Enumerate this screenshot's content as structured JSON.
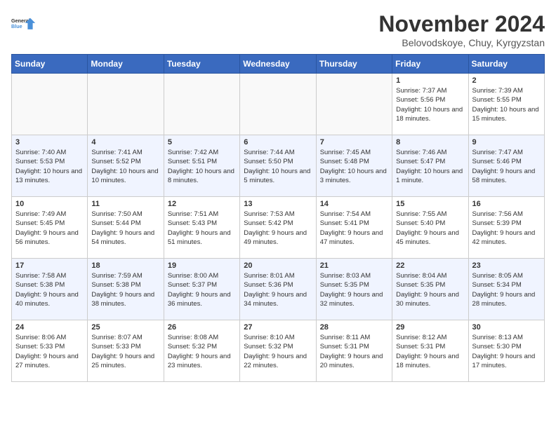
{
  "logo": {
    "line1": "General",
    "line2": "Blue"
  },
  "title": "November 2024",
  "subtitle": "Belovodskoye, Chuy, Kyrgyzstan",
  "weekdays": [
    "Sunday",
    "Monday",
    "Tuesday",
    "Wednesday",
    "Thursday",
    "Friday",
    "Saturday"
  ],
  "weeks": [
    [
      {
        "day": "",
        "detail": ""
      },
      {
        "day": "",
        "detail": ""
      },
      {
        "day": "",
        "detail": ""
      },
      {
        "day": "",
        "detail": ""
      },
      {
        "day": "",
        "detail": ""
      },
      {
        "day": "1",
        "detail": "Sunrise: 7:37 AM\nSunset: 5:56 PM\nDaylight: 10 hours and 18 minutes."
      },
      {
        "day": "2",
        "detail": "Sunrise: 7:39 AM\nSunset: 5:55 PM\nDaylight: 10 hours and 15 minutes."
      }
    ],
    [
      {
        "day": "3",
        "detail": "Sunrise: 7:40 AM\nSunset: 5:53 PM\nDaylight: 10 hours and 13 minutes."
      },
      {
        "day": "4",
        "detail": "Sunrise: 7:41 AM\nSunset: 5:52 PM\nDaylight: 10 hours and 10 minutes."
      },
      {
        "day": "5",
        "detail": "Sunrise: 7:42 AM\nSunset: 5:51 PM\nDaylight: 10 hours and 8 minutes."
      },
      {
        "day": "6",
        "detail": "Sunrise: 7:44 AM\nSunset: 5:50 PM\nDaylight: 10 hours and 5 minutes."
      },
      {
        "day": "7",
        "detail": "Sunrise: 7:45 AM\nSunset: 5:48 PM\nDaylight: 10 hours and 3 minutes."
      },
      {
        "day": "8",
        "detail": "Sunrise: 7:46 AM\nSunset: 5:47 PM\nDaylight: 10 hours and 1 minute."
      },
      {
        "day": "9",
        "detail": "Sunrise: 7:47 AM\nSunset: 5:46 PM\nDaylight: 9 hours and 58 minutes."
      }
    ],
    [
      {
        "day": "10",
        "detail": "Sunrise: 7:49 AM\nSunset: 5:45 PM\nDaylight: 9 hours and 56 minutes."
      },
      {
        "day": "11",
        "detail": "Sunrise: 7:50 AM\nSunset: 5:44 PM\nDaylight: 9 hours and 54 minutes."
      },
      {
        "day": "12",
        "detail": "Sunrise: 7:51 AM\nSunset: 5:43 PM\nDaylight: 9 hours and 51 minutes."
      },
      {
        "day": "13",
        "detail": "Sunrise: 7:53 AM\nSunset: 5:42 PM\nDaylight: 9 hours and 49 minutes."
      },
      {
        "day": "14",
        "detail": "Sunrise: 7:54 AM\nSunset: 5:41 PM\nDaylight: 9 hours and 47 minutes."
      },
      {
        "day": "15",
        "detail": "Sunrise: 7:55 AM\nSunset: 5:40 PM\nDaylight: 9 hours and 45 minutes."
      },
      {
        "day": "16",
        "detail": "Sunrise: 7:56 AM\nSunset: 5:39 PM\nDaylight: 9 hours and 42 minutes."
      }
    ],
    [
      {
        "day": "17",
        "detail": "Sunrise: 7:58 AM\nSunset: 5:38 PM\nDaylight: 9 hours and 40 minutes."
      },
      {
        "day": "18",
        "detail": "Sunrise: 7:59 AM\nSunset: 5:38 PM\nDaylight: 9 hours and 38 minutes."
      },
      {
        "day": "19",
        "detail": "Sunrise: 8:00 AM\nSunset: 5:37 PM\nDaylight: 9 hours and 36 minutes."
      },
      {
        "day": "20",
        "detail": "Sunrise: 8:01 AM\nSunset: 5:36 PM\nDaylight: 9 hours and 34 minutes."
      },
      {
        "day": "21",
        "detail": "Sunrise: 8:03 AM\nSunset: 5:35 PM\nDaylight: 9 hours and 32 minutes."
      },
      {
        "day": "22",
        "detail": "Sunrise: 8:04 AM\nSunset: 5:35 PM\nDaylight: 9 hours and 30 minutes."
      },
      {
        "day": "23",
        "detail": "Sunrise: 8:05 AM\nSunset: 5:34 PM\nDaylight: 9 hours and 28 minutes."
      }
    ],
    [
      {
        "day": "24",
        "detail": "Sunrise: 8:06 AM\nSunset: 5:33 PM\nDaylight: 9 hours and 27 minutes."
      },
      {
        "day": "25",
        "detail": "Sunrise: 8:07 AM\nSunset: 5:33 PM\nDaylight: 9 hours and 25 minutes."
      },
      {
        "day": "26",
        "detail": "Sunrise: 8:08 AM\nSunset: 5:32 PM\nDaylight: 9 hours and 23 minutes."
      },
      {
        "day": "27",
        "detail": "Sunrise: 8:10 AM\nSunset: 5:32 PM\nDaylight: 9 hours and 22 minutes."
      },
      {
        "day": "28",
        "detail": "Sunrise: 8:11 AM\nSunset: 5:31 PM\nDaylight: 9 hours and 20 minutes."
      },
      {
        "day": "29",
        "detail": "Sunrise: 8:12 AM\nSunset: 5:31 PM\nDaylight: 9 hours and 18 minutes."
      },
      {
        "day": "30",
        "detail": "Sunrise: 8:13 AM\nSunset: 5:30 PM\nDaylight: 9 hours and 17 minutes."
      }
    ]
  ]
}
